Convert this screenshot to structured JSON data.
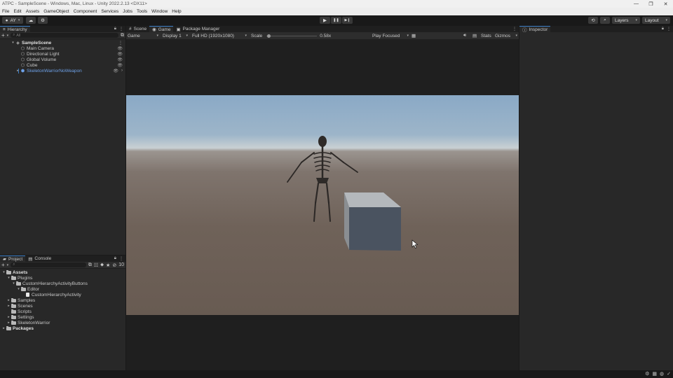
{
  "window": {
    "title": "ATPC - SampleScene - Windows, Mac, Linux - Unity 2022.2.13 <DX11>",
    "controls": [
      "—",
      "❐",
      "✕"
    ]
  },
  "menu": [
    "File",
    "Edit",
    "Assets",
    "GameObject",
    "Component",
    "Services",
    "Jobs",
    "Tools",
    "Window",
    "Help"
  ],
  "toolbar": {
    "account": "AY",
    "play_icons": [
      "▶",
      "❚❚",
      "▶❙"
    ],
    "layers_label": "Layers",
    "layout_label": "Layout"
  },
  "hierarchy": {
    "tab": "Hierarchy",
    "search_placeholder": "All",
    "scene": "SampleScene",
    "items": [
      "Main Camera",
      "Directional Light",
      "Global Volume",
      "Cube"
    ],
    "prefab": "SkeletonWarriorNoWeapon"
  },
  "center_tabs": [
    "Scene",
    "Game",
    "Package Manager"
  ],
  "game_toolbar": {
    "mode": "Game",
    "display": "Display 1",
    "resolution": "Full HD (1920x1080)",
    "scale_label": "Scale",
    "scale_value": 0.58,
    "scale_text": "0.58x",
    "play_focused": "Play Focused",
    "stats": "Stats",
    "gizmos": "Gizmos"
  },
  "inspector": {
    "tab": "Inspector"
  },
  "project": {
    "tabs": [
      "Project",
      "Console"
    ],
    "hidden_count": "10",
    "tree": [
      {
        "label": "Assets",
        "depth": 0,
        "bold": true,
        "arrow": "▾",
        "type": "folder"
      },
      {
        "label": "Plugins",
        "depth": 1,
        "bold": false,
        "arrow": "▾",
        "type": "folder"
      },
      {
        "label": "CustomHierarchyActivityButtons",
        "depth": 2,
        "bold": false,
        "arrow": "▾",
        "type": "folder"
      },
      {
        "label": "Editor",
        "depth": 3,
        "bold": false,
        "arrow": "▾",
        "type": "folder"
      },
      {
        "label": "CustomHierarchyActivity",
        "depth": 4,
        "bold": false,
        "arrow": "",
        "type": "script"
      },
      {
        "label": "Samples",
        "depth": 1,
        "bold": false,
        "arrow": "▸",
        "type": "folder"
      },
      {
        "label": "Scenes",
        "depth": 1,
        "bold": false,
        "arrow": "▸",
        "type": "folder"
      },
      {
        "label": "Scripts",
        "depth": 1,
        "bold": false,
        "arrow": "",
        "type": "folder"
      },
      {
        "label": "Settings",
        "depth": 1,
        "bold": false,
        "arrow": "▸",
        "type": "folder"
      },
      {
        "label": "SkeletonWarrior",
        "depth": 1,
        "bold": false,
        "arrow": "▸",
        "type": "folder"
      },
      {
        "label": "Packages",
        "depth": 0,
        "bold": true,
        "arrow": "▸",
        "type": "folder"
      }
    ]
  },
  "colors": {
    "accent": "#3d7fc6",
    "prefab_text": "#6ea1e8",
    "sky": "#9db5c9",
    "ground": "#6f6259",
    "cube_front": "#4a5360",
    "cube_top": "#b4b8bc"
  }
}
